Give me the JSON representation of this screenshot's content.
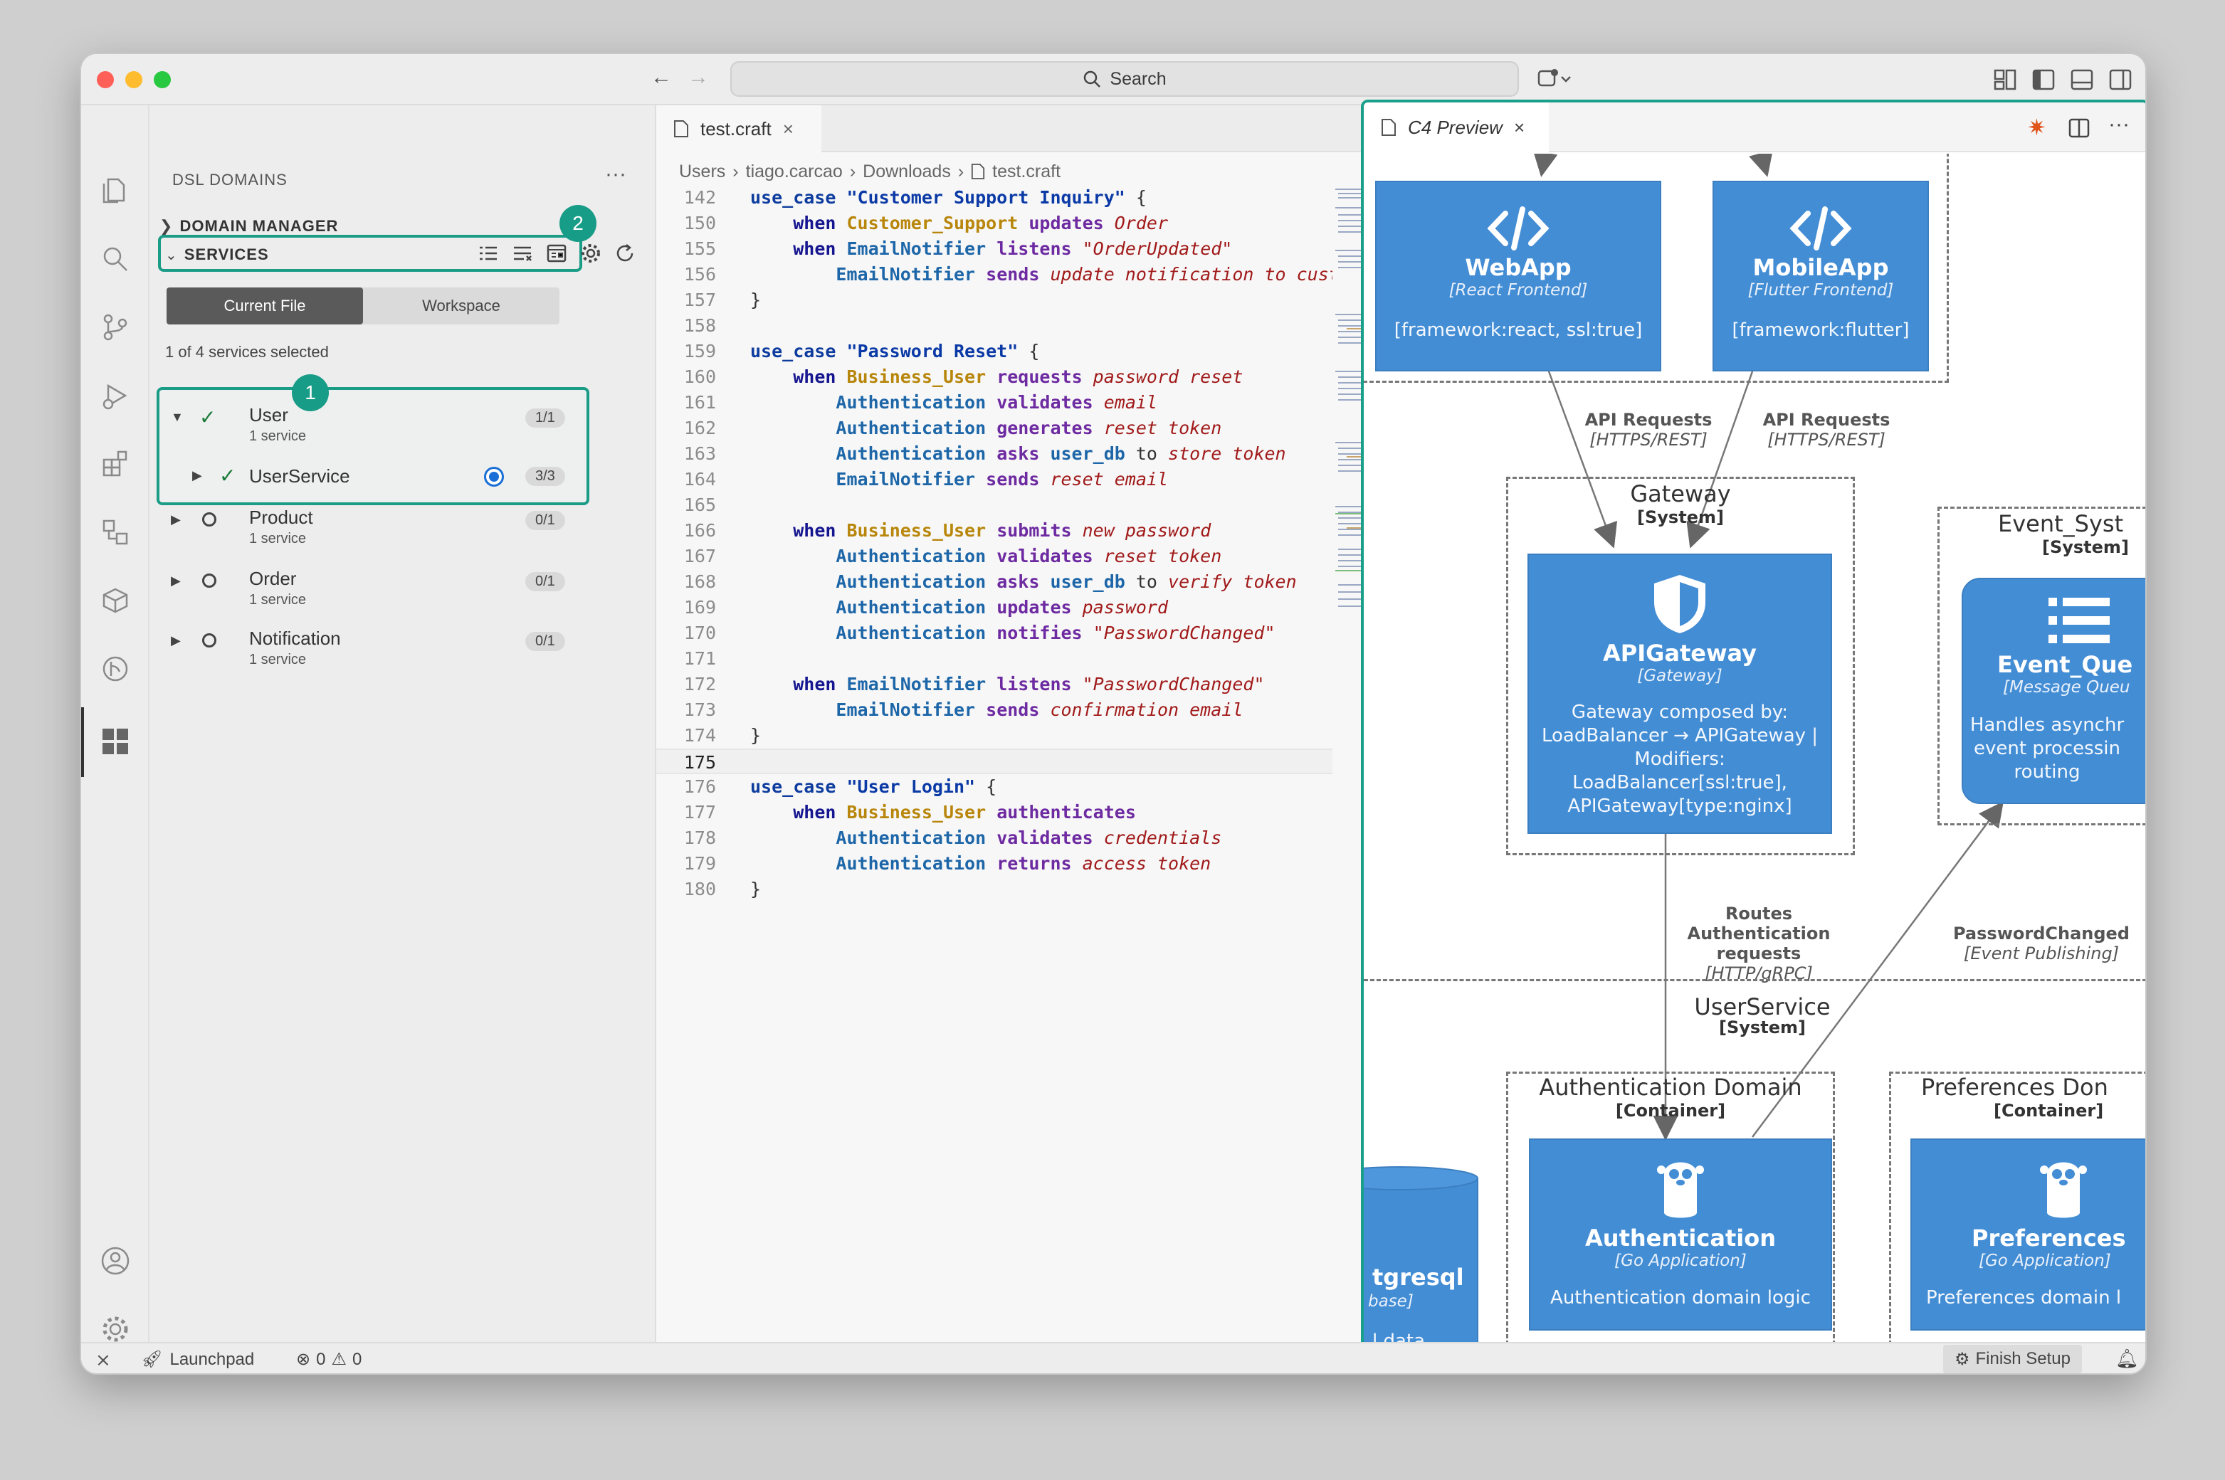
{
  "titlebar": {
    "search_label": "Search",
    "colors": {
      "close": "#ff5f57",
      "minimize": "#febc2e",
      "zoom": "#28c840"
    }
  },
  "sidebar": {
    "title": "DSL DOMAINS",
    "domain_manager_label": "DOMAIN MANAGER",
    "services_label": "SERVICES",
    "toggle": {
      "current_file": "Current File",
      "workspace": "Workspace",
      "active": "Current File"
    },
    "selection_status": "1 of 4 services selected",
    "domains": [
      {
        "name": "User",
        "sub": "1 service",
        "count": "1/1",
        "checked": true,
        "expanded": true,
        "children": [
          {
            "name": "UserService",
            "count": "3/3",
            "checked": true
          }
        ]
      },
      {
        "name": "Product",
        "sub": "1 service",
        "count": "0/1",
        "checked": false
      },
      {
        "name": "Order",
        "sub": "1 service",
        "count": "0/1",
        "checked": false
      },
      {
        "name": "Notification",
        "sub": "1 service",
        "count": "0/1",
        "checked": false
      }
    ],
    "callouts": {
      "one": "1",
      "two": "2"
    },
    "accent": "#179c87"
  },
  "editor": {
    "tab_label": "test.craft",
    "breadcrumb": [
      "Users",
      "tiago.carcao",
      "Downloads",
      "test.craft"
    ],
    "lines": [
      {
        "n": "142",
        "parts": [
          [
            "kw",
            "use_case "
          ],
          [
            "str",
            "\"Customer Support Inquiry\""
          ],
          [
            "plain",
            " {"
          ]
        ]
      },
      {
        "n": "150",
        "parts": [
          [
            "plain",
            "    "
          ],
          [
            "when",
            "when "
          ],
          [
            "actor",
            "Customer_Support"
          ],
          [
            "verb",
            " updates "
          ],
          [
            "obj",
            "Order"
          ]
        ]
      },
      {
        "n": "155",
        "parts": [
          [
            "plain",
            "    "
          ],
          [
            "when",
            "when "
          ],
          [
            "svc",
            "EmailNotifier"
          ],
          [
            "verb",
            " listens "
          ],
          [
            "obj",
            "\"OrderUpdated\""
          ]
        ]
      },
      {
        "n": "156",
        "parts": [
          [
            "plain",
            "        "
          ],
          [
            "svc",
            "EmailNotifier"
          ],
          [
            "verb",
            " sends "
          ],
          [
            "obj",
            "update notification to custo"
          ]
        ]
      },
      {
        "n": "157",
        "parts": [
          [
            "plain",
            "}"
          ]
        ]
      },
      {
        "n": "158",
        "parts": []
      },
      {
        "n": "159",
        "parts": [
          [
            "kw",
            "use_case "
          ],
          [
            "str",
            "\"Password Reset\""
          ],
          [
            "plain",
            " {"
          ]
        ]
      },
      {
        "n": "160",
        "parts": [
          [
            "plain",
            "    "
          ],
          [
            "when",
            "when "
          ],
          [
            "actor",
            "Business_User"
          ],
          [
            "verb",
            " requests "
          ],
          [
            "obj",
            "password reset"
          ]
        ]
      },
      {
        "n": "161",
        "parts": [
          [
            "plain",
            "        "
          ],
          [
            "svc",
            "Authentication"
          ],
          [
            "verb",
            " validates "
          ],
          [
            "obj",
            "email"
          ]
        ]
      },
      {
        "n": "162",
        "parts": [
          [
            "plain",
            "        "
          ],
          [
            "svc",
            "Authentication"
          ],
          [
            "verb",
            " generates "
          ],
          [
            "obj",
            "reset token"
          ]
        ]
      },
      {
        "n": "163",
        "parts": [
          [
            "plain",
            "        "
          ],
          [
            "svc",
            "Authentication"
          ],
          [
            "verb",
            " asks "
          ],
          [
            "svc",
            "user_db"
          ],
          [
            "plain",
            " to "
          ],
          [
            "obj",
            "store token"
          ]
        ]
      },
      {
        "n": "164",
        "parts": [
          [
            "plain",
            "        "
          ],
          [
            "svc",
            "EmailNotifier"
          ],
          [
            "verb",
            " sends "
          ],
          [
            "obj",
            "reset email"
          ]
        ]
      },
      {
        "n": "165",
        "parts": []
      },
      {
        "n": "166",
        "parts": [
          [
            "plain",
            "    "
          ],
          [
            "when",
            "when "
          ],
          [
            "actor",
            "Business_User"
          ],
          [
            "verb",
            " submits "
          ],
          [
            "obj",
            "new password"
          ]
        ]
      },
      {
        "n": "167",
        "parts": [
          [
            "plain",
            "        "
          ],
          [
            "svc",
            "Authentication"
          ],
          [
            "verb",
            " validates "
          ],
          [
            "obj",
            "reset token"
          ]
        ]
      },
      {
        "n": "168",
        "parts": [
          [
            "plain",
            "        "
          ],
          [
            "svc",
            "Authentication"
          ],
          [
            "verb",
            " asks "
          ],
          [
            "svc",
            "user_db"
          ],
          [
            "plain",
            " to "
          ],
          [
            "obj",
            "verify token"
          ]
        ]
      },
      {
        "n": "169",
        "parts": [
          [
            "plain",
            "        "
          ],
          [
            "svc",
            "Authentication"
          ],
          [
            "verb",
            " updates "
          ],
          [
            "obj",
            "password"
          ]
        ]
      },
      {
        "n": "170",
        "parts": [
          [
            "plain",
            "        "
          ],
          [
            "svc",
            "Authentication"
          ],
          [
            "verb",
            " notifies "
          ],
          [
            "obj",
            "\"PasswordChanged\""
          ]
        ]
      },
      {
        "n": "171",
        "parts": []
      },
      {
        "n": "172",
        "parts": [
          [
            "plain",
            "    "
          ],
          [
            "when",
            "when "
          ],
          [
            "svc",
            "EmailNotifier"
          ],
          [
            "verb",
            " listens "
          ],
          [
            "obj",
            "\"PasswordChanged\""
          ]
        ]
      },
      {
        "n": "173",
        "parts": [
          [
            "plain",
            "        "
          ],
          [
            "svc",
            "EmailNotifier"
          ],
          [
            "verb",
            " sends "
          ],
          [
            "obj",
            "confirmation email"
          ]
        ]
      },
      {
        "n": "174",
        "parts": [
          [
            "plain",
            "}"
          ]
        ]
      },
      {
        "n": "175",
        "parts": []
      },
      {
        "n": "176",
        "parts": [
          [
            "kw",
            "use_case "
          ],
          [
            "str",
            "\"User Login\""
          ],
          [
            "plain",
            " {"
          ]
        ]
      },
      {
        "n": "177",
        "parts": [
          [
            "plain",
            "    "
          ],
          [
            "when",
            "when "
          ],
          [
            "actor",
            "Business_User"
          ],
          [
            "verb",
            " authenticates"
          ]
        ]
      },
      {
        "n": "178",
        "parts": [
          [
            "plain",
            "        "
          ],
          [
            "svc",
            "Authentication"
          ],
          [
            "verb",
            " validates "
          ],
          [
            "obj",
            "credentials"
          ]
        ]
      },
      {
        "n": "179",
        "parts": [
          [
            "plain",
            "        "
          ],
          [
            "svc",
            "Authentication"
          ],
          [
            "verb",
            " returns "
          ],
          [
            "obj",
            "access token"
          ]
        ]
      },
      {
        "n": "180",
        "parts": [
          [
            "plain",
            "}"
          ]
        ]
      }
    ]
  },
  "preview": {
    "tab_label": "C4 Preview",
    "webapp": {
      "name": "WebApp",
      "tech": "[React Frontend]",
      "desc": "[framework:react, ssl:true]"
    },
    "mobileapp": {
      "name": "MobileApp",
      "tech": "[Flutter Frontend]",
      "desc": "[framework:flutter]"
    },
    "rel_api_1": {
      "label": "API Requests",
      "tech": "[HTTPS/REST]"
    },
    "rel_api_2": {
      "label": "API Requests",
      "tech": "[HTTPS/REST]"
    },
    "gateway_boundary": {
      "name": "Gateway",
      "type": "[System]"
    },
    "apigateway": {
      "name": "APIGateway",
      "tech": "[Gateway]",
      "desc": "Gateway composed by: LoadBalancer → APIGateway | Modifiers: LoadBalancer[ssl:true], APIGateway[type:nginx]"
    },
    "event_boundary": {
      "name": "Event_Syst",
      "type": "[System]"
    },
    "event_queue": {
      "name": "Event_Que",
      "tech": "[Message Queu",
      "desc": "Handles asynchr event processin routing"
    },
    "rel_routes": {
      "label": "Routes Authentication requests",
      "tech": "[HTTP/gRPC]"
    },
    "rel_pwchanged": {
      "label": "PasswordChanged",
      "tech": "[Event Publishing]"
    },
    "userservice_boundary": {
      "name": "UserService",
      "type": "[System]"
    },
    "auth_boundary": {
      "name": "Authentication Domain",
      "type": "[Container]"
    },
    "pref_boundary": {
      "name": "Preferences Don",
      "type": "[Container]"
    },
    "postgres": {
      "name": "tgresql",
      "tech": "base]",
      "desc": "l data"
    },
    "authentication": {
      "name": "Authentication",
      "tech": "[Go Application]",
      "desc": "Authentication domain logic"
    },
    "preferences": {
      "name": "Preferences",
      "tech": "[Go Application]",
      "desc": "Preferences domain l"
    },
    "box_color": "#438dd5"
  },
  "statusbar": {
    "launchpad": "Launchpad",
    "errors": "0",
    "warnings": "0",
    "finish_setup": "Finish Setup"
  }
}
